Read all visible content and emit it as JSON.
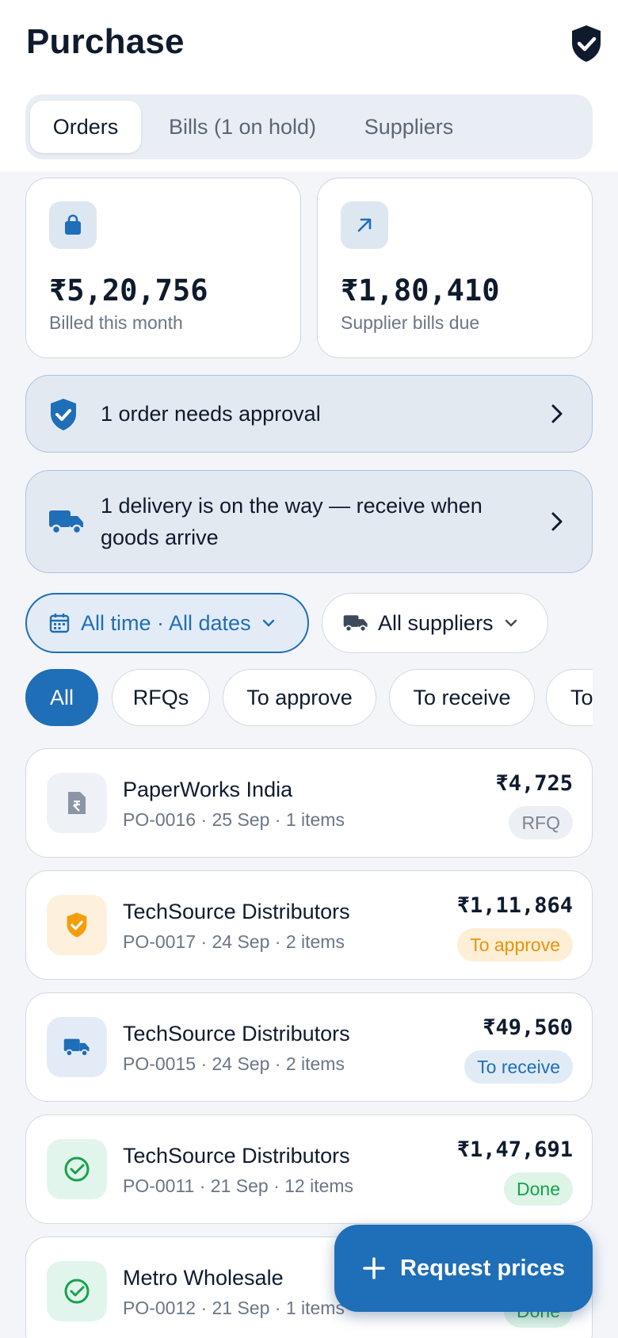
{
  "header": {
    "title": "Purchase",
    "status_icon": "shield-check-icon"
  },
  "tabs": [
    {
      "label": "Orders",
      "active": true
    },
    {
      "label": "Bills (1 on hold)",
      "active": false
    },
    {
      "label": "Suppliers",
      "active": false
    }
  ],
  "stats": [
    {
      "value": "₹5,20,756",
      "label": "Billed this month",
      "icon": "shopping-bag-icon"
    },
    {
      "value": "₹1,80,410",
      "label": "Supplier bills due",
      "icon": "arrow-up-right-icon"
    }
  ],
  "alerts": [
    {
      "text": "1 order needs approval",
      "icon": "shield-check-icon"
    },
    {
      "line1": "1 delivery is on the way — receive when",
      "line2": "goods arrive",
      "icon": "truck-icon"
    }
  ],
  "filters": {
    "date": "All time · All dates",
    "supplier": "All suppliers"
  },
  "chips": [
    "All",
    "RFQs",
    "To approve",
    "To receive",
    "To"
  ],
  "orders": [
    {
      "name": "PaperWorks India",
      "meta": "PO-0016 · 25 Sep · 1 items",
      "amount": "₹4,725",
      "status": "RFQ",
      "icon": "document-rupee-icon"
    },
    {
      "name": "TechSource Distributors",
      "meta": "PO-0017 · 24 Sep · 2 items",
      "amount": "₹1,11,864",
      "status": "To approve",
      "icon": "shield-check-icon"
    },
    {
      "name": "TechSource Distributors",
      "meta": "PO-0015 · 24 Sep · 2 items",
      "amount": "₹49,560",
      "status": "To receive",
      "icon": "truck-icon"
    },
    {
      "name": "TechSource Distributors",
      "meta": "PO-0011 · 21 Sep · 12 items",
      "amount": "₹1,47,691",
      "status": "Done",
      "icon": "check-circle-icon"
    },
    {
      "name": "Metro Wholesale",
      "meta": "PO-0012 · 21 Sep · 1 items",
      "amount": "",
      "status": "Done",
      "icon": "check-circle-icon"
    }
  ],
  "fab": {
    "label": "Request prices",
    "icon": "plus-icon"
  },
  "colors": {
    "primary": "#1f6eb8",
    "text": "#0f1b2d",
    "muted": "#6b7685",
    "approve": "#f59e0b",
    "done": "#16a34a"
  }
}
